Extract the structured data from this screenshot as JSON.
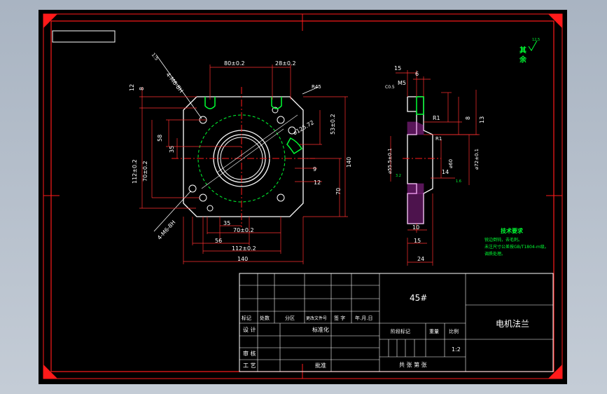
{
  "title_block": {
    "material": "45#",
    "part_name": "电机法兰",
    "header_labels": [
      "标记",
      "处数",
      "分区",
      "更改文件号",
      "签 字",
      "年.月.日"
    ],
    "design": "设 计",
    "standardize": "标准化",
    "stage_mark": "阶段标记",
    "weight": "重量",
    "scale_label": "比例",
    "scale_value": "1:2",
    "review": "审 核",
    "process": "工 艺",
    "approve": "批准",
    "sheets": "共  张 第  张"
  },
  "notes": {
    "title": "技术要求",
    "lines": [
      "锐边倒钝，去毛刺。",
      "未注尺寸公差按GB/T1804-m级。",
      "调质处理。"
    ]
  },
  "roughness_rest": "其 余",
  "roughness_value": "12.5",
  "front_dims": {
    "d80": "80±0.2",
    "d28": "28±0.2",
    "d12": "12",
    "d8": "8",
    "d58": "58",
    "d35v": "35",
    "d112v": "112±0.2",
    "d70v": "70±0.2",
    "dia125": "⌀125.72",
    "d53": "53±0.2",
    "d140v": "140",
    "d9": "9",
    "d12b": "12",
    "d70r": "70",
    "d35h": "35",
    "d70h": "70±0.2",
    "d56": "56",
    "d112h": "112±0.2",
    "d140h": "140",
    "holes1": "4-M6-8H",
    "holes2": "4-M6-8H",
    "hole_label": "1:5",
    "r45": "R45"
  },
  "side_dims": {
    "d15": "15",
    "d6": "6",
    "m5": "M5",
    "chamfer": "C0.5",
    "r1": "R1",
    "d8": "8",
    "d13": "13",
    "dia55": "⌀55.5±0.1",
    "dia60": "⌀60",
    "dia72": "⌀72±0.1",
    "d14": "14",
    "d10": "10",
    "d15b": "15",
    "d24": "24",
    "ra1": "3.2",
    "ra2": "1.6",
    "ra3": "R1"
  }
}
